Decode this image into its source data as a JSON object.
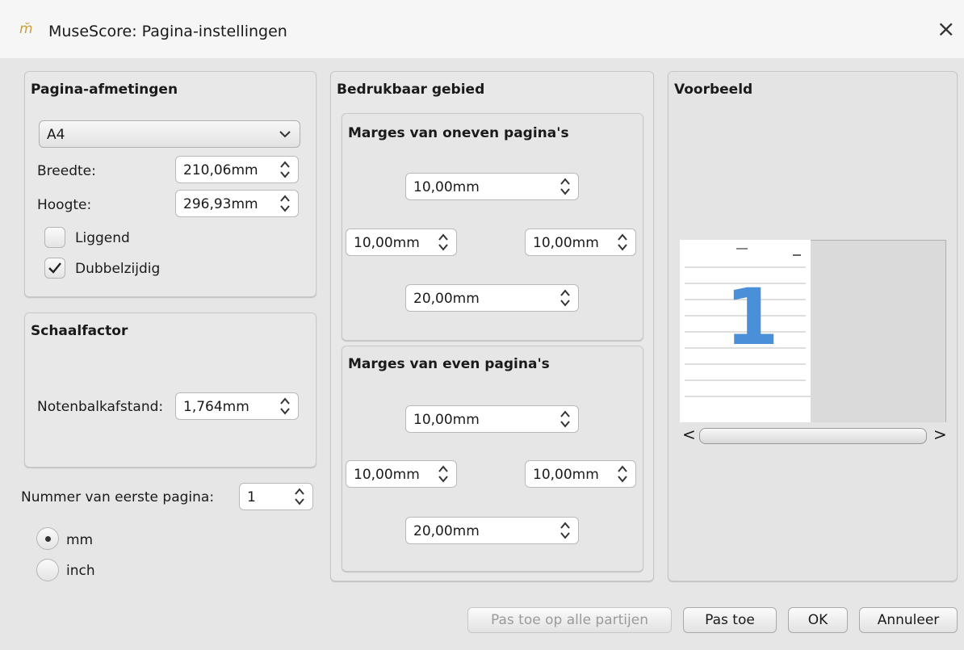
{
  "window": {
    "title": "MuseScore: Pagina-instellingen",
    "app_icon": "musescore-icon",
    "close_glyph": "×"
  },
  "page_size": {
    "group_title": "Pagina-afmetingen",
    "format": "A4",
    "width_label": "Breedte:",
    "width_value": "210,06mm",
    "height_label": "Hoogte:",
    "height_value": "296,93mm",
    "landscape_label": "Liggend",
    "landscape_checked": false,
    "twosided_label": "Dubbelzijdig",
    "twosided_checked": true
  },
  "scale": {
    "group_title": "Schaalfactor",
    "staff_space_label": "Notenbalkafstand:",
    "staff_space_value": "1,764mm"
  },
  "first_page": {
    "label": "Nummer van eerste pagina:",
    "value": "1"
  },
  "units": {
    "mm_label": "mm",
    "inch_label": "inch",
    "selected": "mm"
  },
  "printable_area": {
    "group_title": "Bedrukbaar gebied",
    "odd": {
      "title": "Marges van oneven pagina's",
      "top": "10,00mm",
      "left": "10,00mm",
      "right": "10,00mm",
      "bottom": "20,00mm"
    },
    "even": {
      "title": "Marges van even pagina's",
      "top": "10,00mm",
      "left": "10,00mm",
      "right": "10,00mm",
      "bottom": "20,00mm"
    }
  },
  "preview": {
    "group_title": "Voorbeeld",
    "page_number": "1"
  },
  "buttons": {
    "apply_all": "Pas toe op alle partijen",
    "apply": "Pas toe",
    "ok": "OK",
    "cancel": "Annuleer"
  },
  "colors": {
    "page_number_color": "#4a90d9",
    "window_bg": "#e6e6e6"
  }
}
